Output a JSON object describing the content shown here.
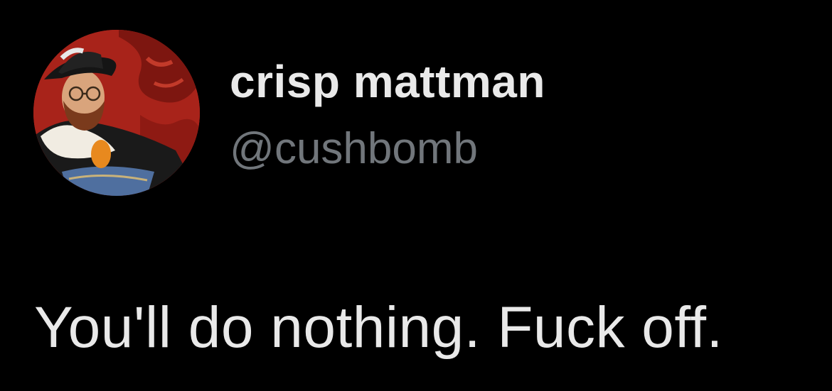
{
  "tweet": {
    "author": {
      "display_name": "crisp mattman",
      "handle": "@cushbomb",
      "avatar_icon": "avatar-portrait-icon"
    },
    "text": "You'll do nothing. Fuck off."
  },
  "colors": {
    "background": "#000000",
    "primary_text": "#e9e9e9",
    "secondary_text": "#71767b",
    "avatar_background": "#a8231a"
  }
}
